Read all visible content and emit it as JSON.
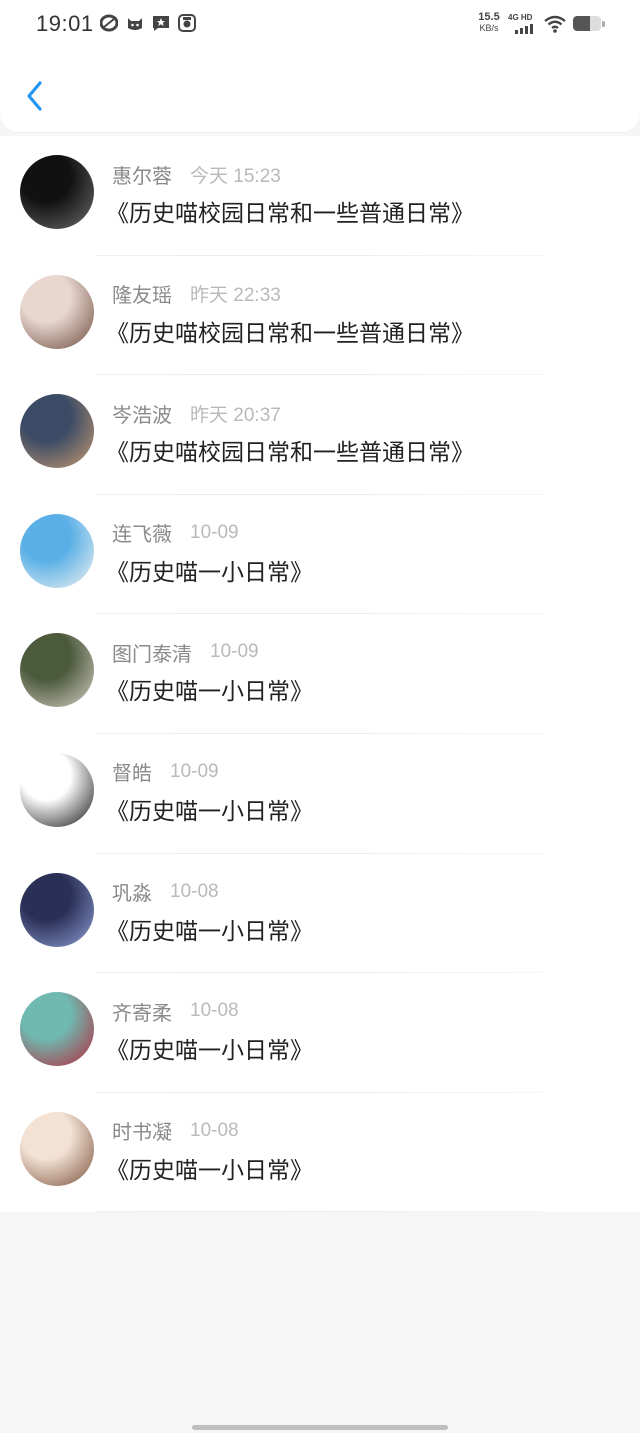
{
  "status_bar": {
    "time": "19:01",
    "net_speed_value": "15.5",
    "net_speed_unit": "KB/s",
    "network_label": "4G HD",
    "battery_level": 0.6
  },
  "header": {
    "back_icon": "chevron-left-icon",
    "accent_color": "#2196f3"
  },
  "comments": [
    {
      "name": "惠尔蓉",
      "time": "今天 15:23",
      "title": "《历史喵校园日常和一些普通日常》",
      "avatar_colors": [
        "#111111",
        "#6d6d6d"
      ]
    },
    {
      "name": "隆友瑶",
      "time": "昨天 22:33",
      "title": "《历史喵校园日常和一些普通日常》",
      "avatar_colors": [
        "#e8d6cf",
        "#6b4a3a"
      ]
    },
    {
      "name": "岑浩波",
      "time": "昨天 20:37",
      "title": "《历史喵校园日常和一些普通日常》",
      "avatar_colors": [
        "#3b4b66",
        "#c99b70"
      ]
    },
    {
      "name": "连飞薇",
      "time": "10-09",
      "title": "《历史喵一小日常》",
      "avatar_colors": [
        "#5ab0e6",
        "#f2f2f2"
      ]
    },
    {
      "name": "图门泰清",
      "time": "10-09",
      "title": "《历史喵一小日常》",
      "avatar_colors": [
        "#4c5a3c",
        "#d8cfc7"
      ]
    },
    {
      "name": "督皓",
      "time": "10-09",
      "title": "《历史喵一小日常》",
      "avatar_colors": [
        "#ffffff",
        "#111111"
      ]
    },
    {
      "name": "巩淼",
      "time": "10-08",
      "title": "《历史喵一小日常》",
      "avatar_colors": [
        "#2a2f55",
        "#8fa0d8"
      ]
    },
    {
      "name": "齐寄柔",
      "time": "10-08",
      "title": "《历史喵一小日常》",
      "avatar_colors": [
        "#6fb9b0",
        "#b8263a"
      ]
    },
    {
      "name": "时书凝",
      "time": "10-08",
      "title": "《历史喵一小日常》",
      "avatar_colors": [
        "#f3e2d4",
        "#7a4f3a"
      ]
    }
  ]
}
